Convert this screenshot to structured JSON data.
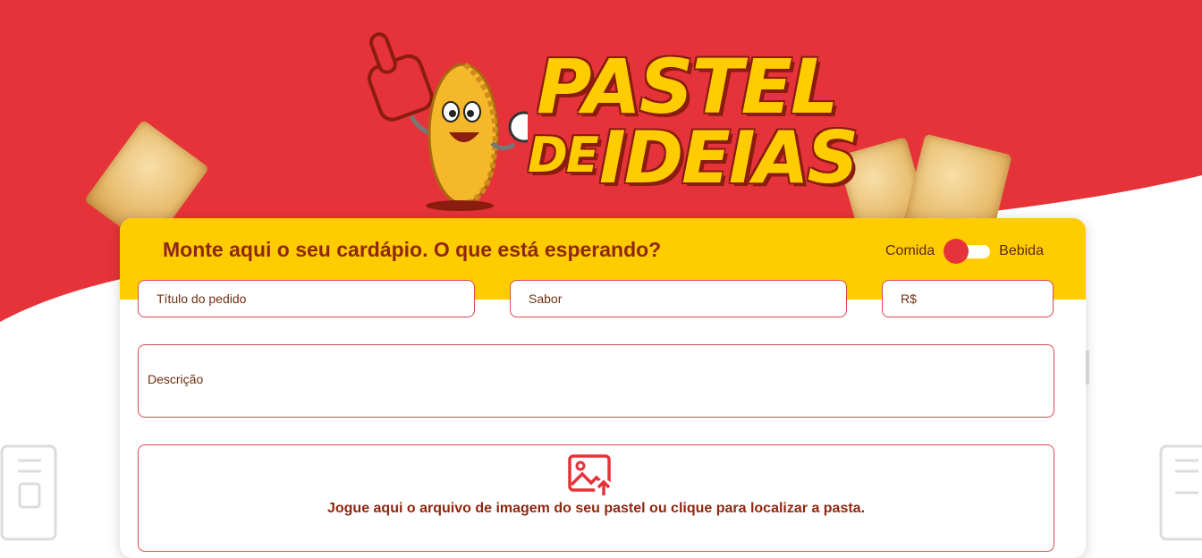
{
  "brand": {
    "logo_line1": "PASTEL",
    "logo_line2a": "DE",
    "logo_line2b": "IDEIAS"
  },
  "colors": {
    "primary_red": "#e63339",
    "header_yellow": "#ffcc00",
    "title_brown": "#8f2710"
  },
  "form": {
    "heading": "Monte aqui o seu cardápio. O que está esperando?",
    "toggle": {
      "left_label": "Comida",
      "right_label": "Bebida",
      "selected": "Comida"
    },
    "fields": {
      "title_placeholder": "Título do pedido",
      "flavor_placeholder": "Sabor",
      "price_placeholder": "R$",
      "description_placeholder": "Descrição"
    },
    "upload": {
      "icon": "image-upload-icon",
      "text": "Jogue aqui o arquivo de imagem do seu pastel ou clique para localizar a pasta."
    }
  }
}
